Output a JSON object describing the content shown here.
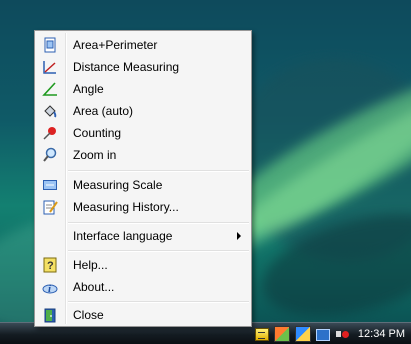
{
  "menu": {
    "items": [
      {
        "label": "Area+Perimeter",
        "icon": "area-perimeter-icon"
      },
      {
        "label": "Distance Measuring",
        "icon": "distance-measuring-icon"
      },
      {
        "label": "Angle",
        "icon": "angle-icon"
      },
      {
        "label": "Area (auto)",
        "icon": "paint-bucket-icon"
      },
      {
        "label": "Counting",
        "icon": "pushpin-icon"
      },
      {
        "label": "Zoom in",
        "icon": "magnifier-icon"
      },
      {
        "label": "Measuring Scale",
        "icon": "scale-icon"
      },
      {
        "label": "Measuring History...",
        "icon": "history-notepad-icon"
      },
      {
        "label": "Interface language",
        "icon": ""
      },
      {
        "label": "Help...",
        "icon": "help-icon"
      },
      {
        "label": "About...",
        "icon": "about-info-icon"
      },
      {
        "label": "Close",
        "icon": "close-door-icon"
      }
    ]
  },
  "taskbar": {
    "clock": "12:34 PM"
  }
}
